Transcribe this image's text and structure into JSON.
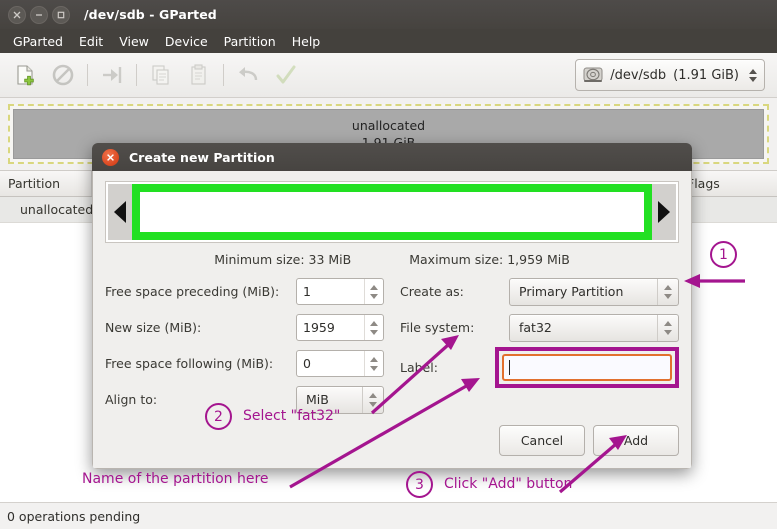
{
  "window": {
    "title": "/dev/sdb - GParted",
    "controls": [
      {
        "name": "close-window-button",
        "glyph": "×"
      },
      {
        "name": "minimize-window-button",
        "glyph": "−"
      },
      {
        "name": "maximize-window-button",
        "glyph": "□"
      }
    ]
  },
  "menubar": {
    "items": [
      "GParted",
      "Edit",
      "View",
      "Device",
      "Partition",
      "Help"
    ]
  },
  "toolbar": {
    "buttons": [
      {
        "name": "new-partition-button",
        "title": "New"
      },
      {
        "name": "delete-partition-button",
        "title": "Delete"
      },
      {
        "name": "resize-move-button",
        "title": "Resize/Move"
      },
      {
        "name": "copy-button",
        "title": "Copy"
      },
      {
        "name": "paste-button",
        "title": "Paste"
      },
      {
        "name": "undo-button",
        "title": "Undo"
      },
      {
        "name": "apply-button",
        "title": "Apply"
      }
    ],
    "device_selector": {
      "device": "/dev/sdb",
      "size": "(1.91 GiB)"
    }
  },
  "disk_graphic": {
    "partition_name": "unallocated",
    "partition_size": "1.91 GiB"
  },
  "partition_list": {
    "columns": [
      "Partition",
      "Flags"
    ],
    "rows": [
      {
        "partition": "unallocated",
        "flags": ""
      }
    ]
  },
  "statusbar": {
    "text": "0 operations pending"
  },
  "dialog": {
    "title": "Create new Partition",
    "close_glyph": "×",
    "minimum_size": "Minimum size: 33 MiB",
    "maximum_size": "Maximum size: 1,959 MiB",
    "fields": {
      "free_preceding_label": "Free space preceding (MiB):",
      "free_preceding_value": "1",
      "new_size_label": "New size (MiB):",
      "new_size_value": "1959",
      "free_following_label": "Free space following (MiB):",
      "free_following_value": "0",
      "align_to_label": "Align to:",
      "align_to_value": "MiB",
      "create_as_label": "Create as:",
      "create_as_value": "Primary Partition",
      "file_system_label": "File system:",
      "file_system_value": "fat32",
      "label_label": "Label:",
      "label_value": ""
    },
    "buttons": {
      "cancel": "Cancel",
      "add": "Add"
    }
  },
  "annotations": {
    "color": "#a4158f",
    "step1_number": "1",
    "step2_number": "2",
    "step2_text": "Select \"fat32\"",
    "step3_number": "3",
    "step3_text": "Click \"Add\" button",
    "label_hint_text": "Name of the partition here"
  }
}
